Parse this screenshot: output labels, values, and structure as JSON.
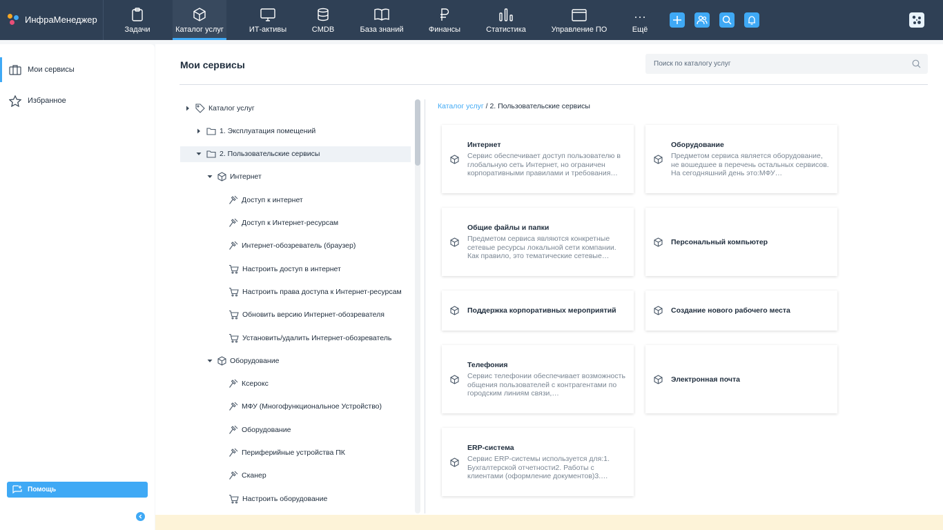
{
  "app": {
    "logo_text": "ИнфраМенеджер"
  },
  "nav": {
    "items": [
      {
        "id": "tasks",
        "label": "Задачи",
        "icon": "clipboard-icon"
      },
      {
        "id": "catalog",
        "label": "Каталог услуг",
        "icon": "cube-icon",
        "active": true
      },
      {
        "id": "it-assets",
        "label": "ИТ-активы",
        "icon": "monitor-icon"
      },
      {
        "id": "cmdb",
        "label": "CMDB",
        "icon": "database-icon"
      },
      {
        "id": "knowledge",
        "label": "База знаний",
        "icon": "book-icon"
      },
      {
        "id": "finance",
        "label": "Финансы",
        "icon": "ruble-icon"
      },
      {
        "id": "stats",
        "label": "Статистика",
        "icon": "bar-chart-icon"
      },
      {
        "id": "software",
        "label": "Управление ПО",
        "icon": "window-icon"
      },
      {
        "id": "more",
        "label": "Ещё",
        "icon": "more-icon"
      }
    ]
  },
  "sidebar": {
    "items": [
      {
        "label": "Мои сервисы",
        "icon": "briefcase-icon",
        "active": true
      },
      {
        "label": "Избранное",
        "icon": "star-icon"
      }
    ],
    "help_label": "Помощь"
  },
  "main": {
    "title": "Мои сервисы",
    "search_placeholder": "Поиск по каталогу услуг",
    "breadcrumb_root": "Каталог услуг",
    "breadcrumb_sep": " / ",
    "breadcrumb_current": "2. Пользовательские сервисы"
  },
  "tree": [
    {
      "label": "Каталог услуг",
      "level": 0,
      "icon": "tag-icon",
      "arrow": "right"
    },
    {
      "label": "1. Эксплуатация помещений",
      "level": 1,
      "icon": "folder-icon",
      "arrow": "right"
    },
    {
      "label": "2. Пользовательские сервисы",
      "level": 1,
      "icon": "folder-icon",
      "arrow": "down",
      "selected": true
    },
    {
      "label": "Интернет",
      "level": 2,
      "icon": "cube-icon",
      "arrow": "down"
    },
    {
      "label": "Доступ к интернет",
      "level": 3,
      "icon": "hammer-icon"
    },
    {
      "label": "Доступ к Интернет-ресурсам",
      "level": 3,
      "icon": "hammer-icon"
    },
    {
      "label": "Интернет-обозреватель (браузер)",
      "level": 3,
      "icon": "hammer-icon"
    },
    {
      "label": "Настроить доступ в интернет",
      "level": 3,
      "icon": "cart-icon"
    },
    {
      "label": "Настроить права доступа к Интернет-ресурсам",
      "level": 3,
      "icon": "cart-icon"
    },
    {
      "label": "Обновить версию Интернет-обозревателя",
      "level": 3,
      "icon": "cart-icon"
    },
    {
      "label": "Установить/удалить Интернет-обозреватель",
      "level": 3,
      "icon": "cart-icon"
    },
    {
      "label": "Оборудование",
      "level": 2,
      "icon": "cube-icon",
      "arrow": "down"
    },
    {
      "label": "Ксерокс",
      "level": 3,
      "icon": "hammer-icon"
    },
    {
      "label": "МФУ (Многофункциональное Устройство)",
      "level": 3,
      "icon": "hammer-icon"
    },
    {
      "label": "Оборудование",
      "level": 3,
      "icon": "hammer-icon"
    },
    {
      "label": "Периферийные устройства ПК",
      "level": 3,
      "icon": "hammer-icon"
    },
    {
      "label": "Сканер",
      "level": 3,
      "icon": "hammer-icon"
    },
    {
      "label": "Настроить оборудование",
      "level": 3,
      "icon": "cart-icon"
    }
  ],
  "cards": [
    {
      "title": "Интернет",
      "desc": "Сервис обеспечивает доступ пользователю в глобальную сеть Интернет, но ограничен корпоративными правилами и требования…"
    },
    {
      "title": "Оборудование",
      "desc": "Предметом сервиса является оборудование, не вошедшее в перечень остальных сервисов. На сегодняшний день это:МФУ…"
    },
    {
      "title": "Общие файлы и папки",
      "desc": "Предметом сервиса являются конкретные сетевые ресурсы локальной сети компании. Как правило, это тематические сетевые…"
    },
    {
      "title": "Персональный компьютер",
      "desc": ""
    },
    {
      "title": "Поддержка корпоративных мероприятий",
      "desc": ""
    },
    {
      "title": "Создание нового рабочего места",
      "desc": ""
    },
    {
      "title": "Телефония",
      "desc": "Сервис телефонии обеспечивает возможность общения пользователей с контрагентами по городским линиям связи,…"
    },
    {
      "title": "Электронная почта",
      "desc": ""
    },
    {
      "title": "ERP-система",
      "desc": "Сервис ERP-системы используется для:1. Бухгалтерской отчетности2. Работы с клиентами (оформление документов)3.…"
    }
  ]
}
